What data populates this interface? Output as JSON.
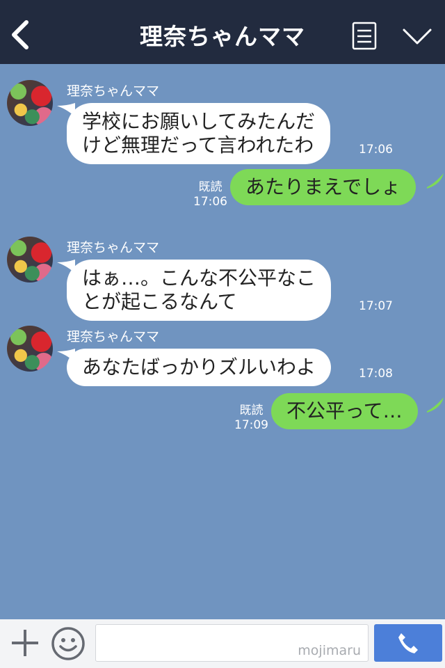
{
  "header": {
    "title": "理奈ちゃんママ"
  },
  "messages": [
    {
      "sender": "理奈ちゃんママ",
      "text_lines": [
        "学校にお願いしてみたんだ",
        "けど無理だって言われたわ"
      ],
      "time": "17:06"
    },
    {
      "sender": "me",
      "text": "あたりまえでしょ",
      "read": "既読",
      "time": "17:06"
    },
    {
      "sender": "理奈ちゃんママ",
      "text_lines": [
        "はぁ…。こんな不公平なこ",
        "とが起こるなんて"
      ],
      "time": "17:07"
    },
    {
      "sender": "理奈ちゃんママ",
      "text": "あなたばっかりズルいわよ",
      "time": "17:08"
    },
    {
      "sender": "me",
      "text": "不公平って…",
      "read": "既読",
      "time": "17:09"
    }
  ],
  "input": {
    "watermark": "mojimaru"
  },
  "colors": {
    "header_bg": "#222b3f",
    "chat_bg": "#7094c0",
    "outgoing_bubble": "#7ed957",
    "incoming_bubble": "#ffffff",
    "call_button": "#4c7fd9"
  },
  "icons": [
    "back-chevron",
    "menu-lines",
    "chevron-down",
    "plus",
    "smiley",
    "phone"
  ]
}
